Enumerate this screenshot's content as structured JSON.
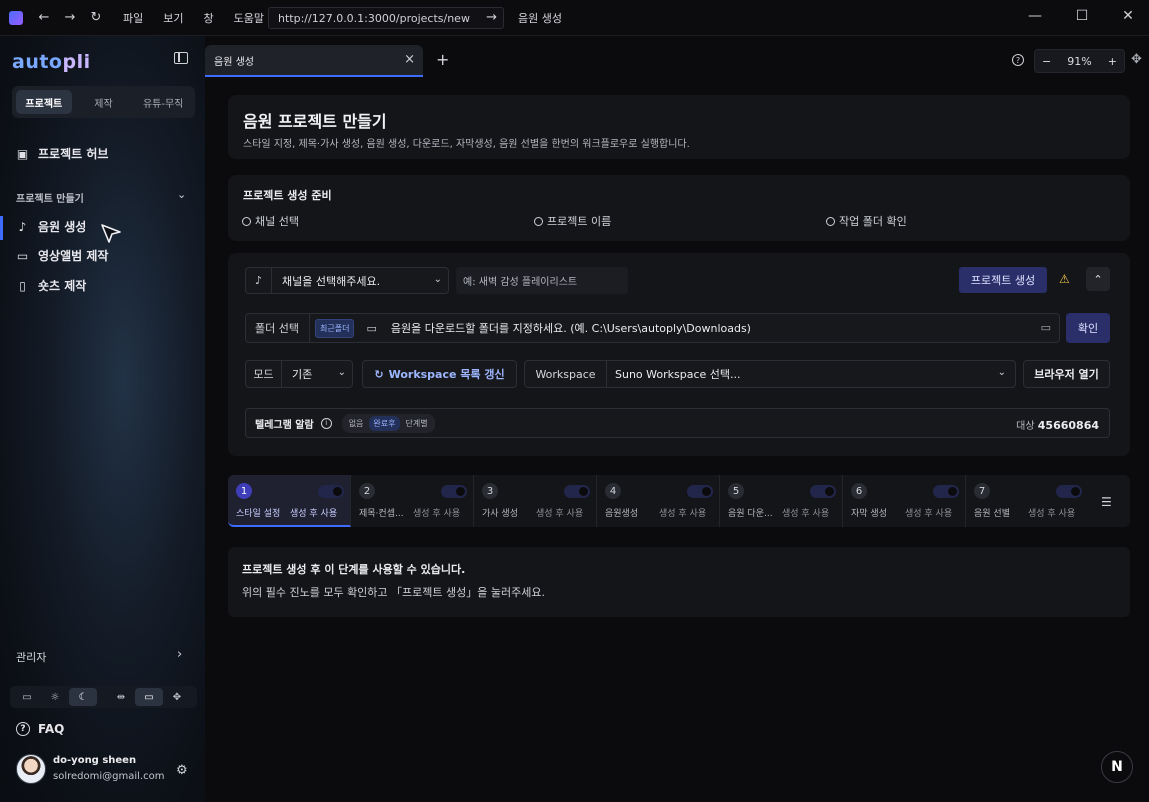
{
  "titlebar": {
    "menus": [
      "파일",
      "보기",
      "창",
      "도움말"
    ],
    "url": "http://127.0.0.1:3000/projects/new",
    "page_title": "음원 생성"
  },
  "sidebar": {
    "logo_main": "auto",
    "logo_accent": "pli",
    "segments": [
      "프로젝트",
      "제작",
      "유튜-무직"
    ],
    "hub": "프로젝트 허브",
    "section": "프로젝트 만들기",
    "items": [
      {
        "label": "음원 생성",
        "icon": "music-note-icon"
      },
      {
        "label": "영상앨범 제작",
        "icon": "video-icon"
      },
      {
        "label": "숏츠 제작",
        "icon": "phone-icon"
      }
    ],
    "admin": "관리자",
    "faq": "FAQ",
    "user_name": "do-yong sheen",
    "user_email": "solredomi@gmail.com"
  },
  "tabs": {
    "active": "음원 생성",
    "zoom": "91%"
  },
  "header": {
    "title": "음원 프로젝트 만들기",
    "subtitle": "스타일 지정, 제목·가사 생성, 음원 생성, 다운로드, 자막생성, 음원 선별을 한번의 워크플로우로 실행합니다."
  },
  "prep": {
    "title": "프로젝트 생성 준비",
    "checks": [
      "채널 선택",
      "프로젝트 이름",
      "작업 폴더 확인"
    ]
  },
  "form": {
    "channel_select": "채널을 선택해주세요.",
    "project_placeholder": "예: 새벽 감성 플레이리스트",
    "create_button": "프로젝트 생성",
    "folder_label": "폴더 선택",
    "folder_badge": "최근폴더",
    "folder_path": "음원을 다운로드할 폴더를 지정하세요. (예. C:\\Users\\autoply\\Downloads)",
    "confirm_button": "확인",
    "mode_label": "모드",
    "mode_value": "기존",
    "refresh_button": "Workspace 목록 갱신",
    "workspace_label": "Workspace",
    "workspace_value": "Suno Workspace 선택...",
    "browser_button": "브라우저 열기",
    "telegram_label": "텔레그램 알람",
    "telegram_chips": [
      "없음",
      "완료후",
      "단계별"
    ],
    "target_label": "대상",
    "target_value": "45660864"
  },
  "steps": [
    {
      "num": "1",
      "name": "스타일 설정",
      "use": "생성 후 사용"
    },
    {
      "num": "2",
      "name": "제목·컨셉...",
      "use": "생성 후 사용"
    },
    {
      "num": "3",
      "name": "가사 생성",
      "use": "생성 후 사용"
    },
    {
      "num": "4",
      "name": "음원생성",
      "use": "생성 후 사용"
    },
    {
      "num": "5",
      "name": "음원 다운...",
      "use": "생성 후 사용"
    },
    {
      "num": "6",
      "name": "자막 생성",
      "use": "생성 후 사용"
    },
    {
      "num": "7",
      "name": "음원 선별",
      "use": "생성 후 사용"
    }
  ],
  "notice": {
    "title": "프로젝트 생성 후 이 단계를 사용할 수 있습니다.",
    "desc": "위의 필수 진노를 모두 확인하고 「프로젝트 생성」을 눌러주세요."
  },
  "colors": {
    "accent": "#3e6cff",
    "primary_button": "#2a2f6a",
    "warning": "#f2c94c"
  }
}
